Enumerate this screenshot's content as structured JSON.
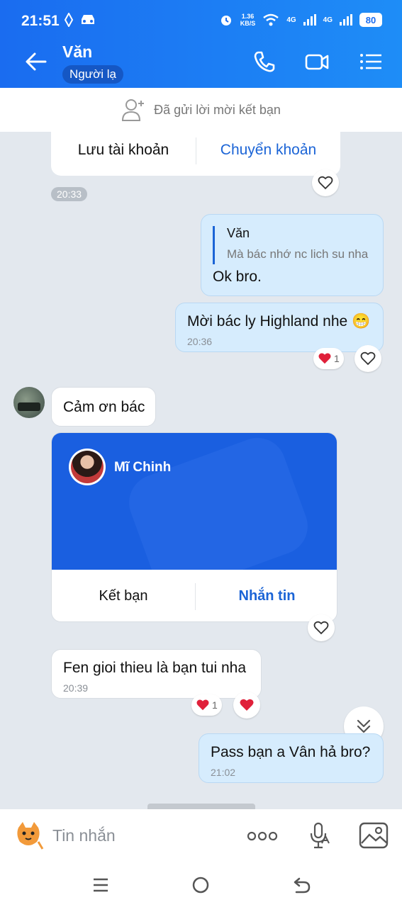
{
  "status_bar": {
    "time": "21:51",
    "speed_value": "1.36",
    "speed_unit": "KB/S",
    "net1": "4G",
    "net2": "4G",
    "battery": "80"
  },
  "header": {
    "contact_name": "Văn",
    "badge": "Người lạ"
  },
  "friend_request": {
    "text": "Đã gửi lời mời kết bạn"
  },
  "messages": {
    "account_card": {
      "save_label": "Lưu tài khoản",
      "transfer_label": "Chuyển khoản"
    },
    "chip_time": "20:33",
    "reply_msg": {
      "quote_author": "Văn",
      "quote_text": "Mà bác nhớ nc lich su nha",
      "text": "Ok bro."
    },
    "invite_msg": {
      "text": "Mời bác ly Highland nhe 😁",
      "time": "20:36",
      "reaction_count": "1"
    },
    "thanks_msg": {
      "text": "Cảm ơn bác"
    },
    "contact_card": {
      "name": "Mĩ Chinh",
      "add_friend_label": "Kết bạn",
      "message_label": "Nhắn tin"
    },
    "intro_msg": {
      "text": "Fen gioi thieu là bạn tui nha",
      "time": "20:39",
      "reaction_count": "1"
    },
    "pass_msg": {
      "text": "Pass bạn a Vân hả bro?",
      "time": "21:02"
    }
  },
  "input": {
    "placeholder": "Tin nhắn"
  },
  "colors": {
    "header_blue": "#1a6cf0",
    "link_blue": "#1b64d6",
    "out_bubble": "#d6ecfd",
    "heart_red": "#e0203a"
  }
}
